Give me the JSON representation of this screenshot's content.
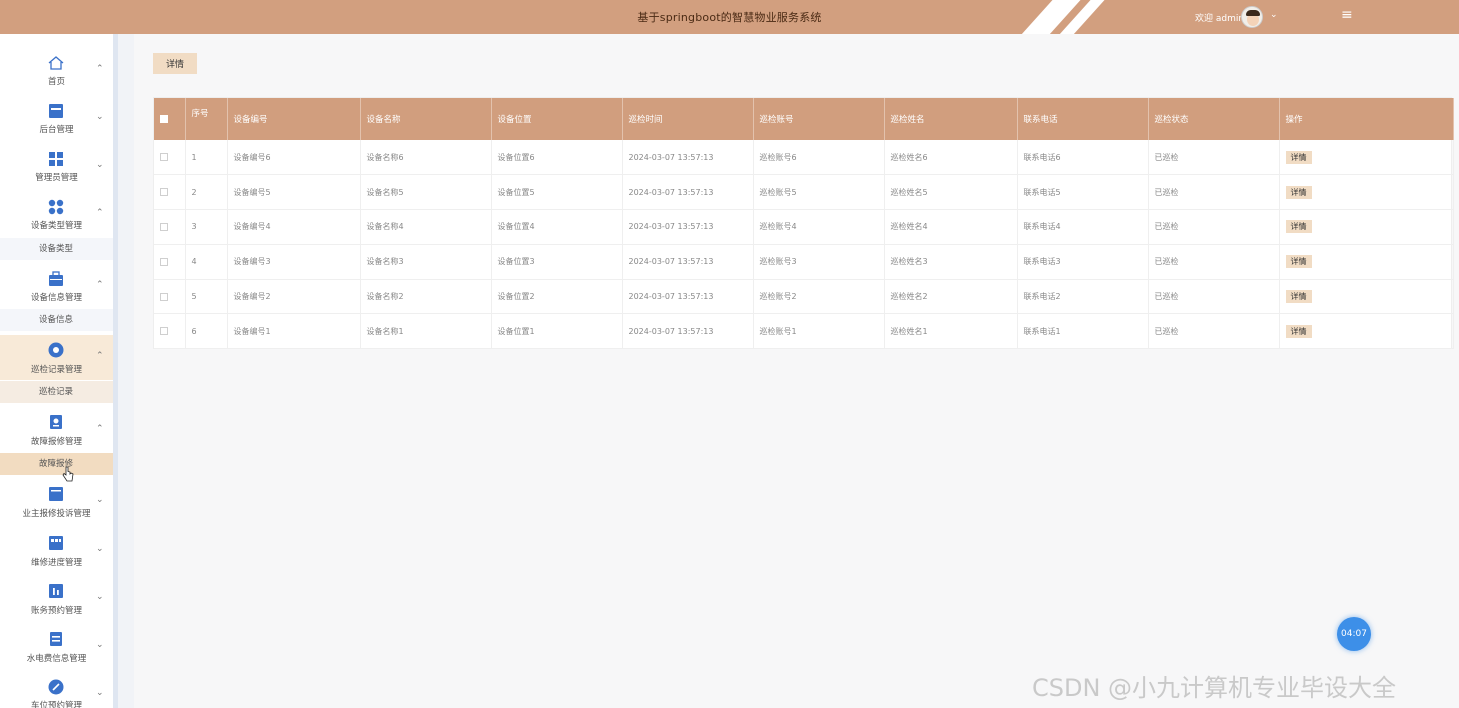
{
  "header": {
    "title": "基于springboot的智慧物业服务系统",
    "welcome": "欢迎 admin",
    "caret": "⌄",
    "menu_icon": "≡"
  },
  "sidebar": {
    "items": [
      {
        "label": "首页",
        "icon": "home-icon",
        "arrow": "⌃"
      },
      {
        "label": "后台管理",
        "icon": "panel-icon",
        "arrow": "⌄"
      },
      {
        "label": "管理员管理",
        "icon": "grid-icon",
        "arrow": "⌄"
      },
      {
        "label": "设备类型管理",
        "icon": "apps-icon",
        "arrow": "⌃",
        "sub": "设备类型"
      },
      {
        "label": "设备信息管理",
        "icon": "briefcase-icon",
        "arrow": "⌃",
        "sub": "设备信息"
      },
      {
        "label": "巡检记录管理",
        "icon": "target-icon",
        "arrow": "⌃",
        "sub": "巡检记录"
      },
      {
        "label": "故障报修管理",
        "icon": "report-icon",
        "arrow": "⌃",
        "sub": "故障报修"
      },
      {
        "label": "业主报修投诉管理",
        "icon": "card-icon",
        "arrow": "⌄"
      },
      {
        "label": "维修进度管理",
        "icon": "progress-icon",
        "arrow": "⌄"
      },
      {
        "label": "账务预约管理",
        "icon": "chart-icon",
        "arrow": "⌄"
      },
      {
        "label": "水电费信息管理",
        "icon": "file-icon",
        "arrow": "⌄"
      },
      {
        "label": "车位预约管理",
        "icon": "compass-icon",
        "arrow": "⌄"
      }
    ]
  },
  "toolbar": {
    "detail_label": "详情"
  },
  "table": {
    "columns": [
      "序号",
      "设备编号",
      "设备名称",
      "设备位置",
      "巡检时间",
      "巡检账号",
      "巡检姓名",
      "联系电话",
      "巡检状态",
      "操作"
    ],
    "rows": [
      {
        "idx": "1",
        "code": "设备编号6",
        "name": "设备名称6",
        "location": "设备位置6",
        "time": "2024-03-07 13:57:13",
        "account": "巡检账号6",
        "inspector": "巡检姓名6",
        "phone": "联系电话6",
        "status": "已巡检",
        "action": "详情"
      },
      {
        "idx": "2",
        "code": "设备编号5",
        "name": "设备名称5",
        "location": "设备位置5",
        "time": "2024-03-07 13:57:13",
        "account": "巡检账号5",
        "inspector": "巡检姓名5",
        "phone": "联系电话5",
        "status": "已巡检",
        "action": "详情"
      },
      {
        "idx": "3",
        "code": "设备编号4",
        "name": "设备名称4",
        "location": "设备位置4",
        "time": "2024-03-07 13:57:13",
        "account": "巡检账号4",
        "inspector": "巡检姓名4",
        "phone": "联系电话4",
        "status": "已巡检",
        "action": "详情"
      },
      {
        "idx": "4",
        "code": "设备编号3",
        "name": "设备名称3",
        "location": "设备位置3",
        "time": "2024-03-07 13:57:13",
        "account": "巡检账号3",
        "inspector": "巡检姓名3",
        "phone": "联系电话3",
        "status": "已巡检",
        "action": "详情"
      },
      {
        "idx": "5",
        "code": "设备编号2",
        "name": "设备名称2",
        "location": "设备位置2",
        "time": "2024-03-07 13:57:13",
        "account": "巡检账号2",
        "inspector": "巡检姓名2",
        "phone": "联系电话2",
        "status": "已巡检",
        "action": "详情"
      },
      {
        "idx": "6",
        "code": "设备编号1",
        "name": "设备名称1",
        "location": "设备位置1",
        "time": "2024-03-07 13:57:13",
        "account": "巡检账号1",
        "inspector": "巡检姓名1",
        "phone": "联系电话1",
        "status": "已巡检",
        "action": "详情"
      }
    ]
  },
  "timer": "04:07",
  "watermark": "CSDN @小九计算机专业毕设大全",
  "colors": {
    "header": "#d29f7f",
    "table_header": "#d19e7e",
    "accent_button": "#f1dcc4",
    "icon_blue": "#3a71c9"
  }
}
